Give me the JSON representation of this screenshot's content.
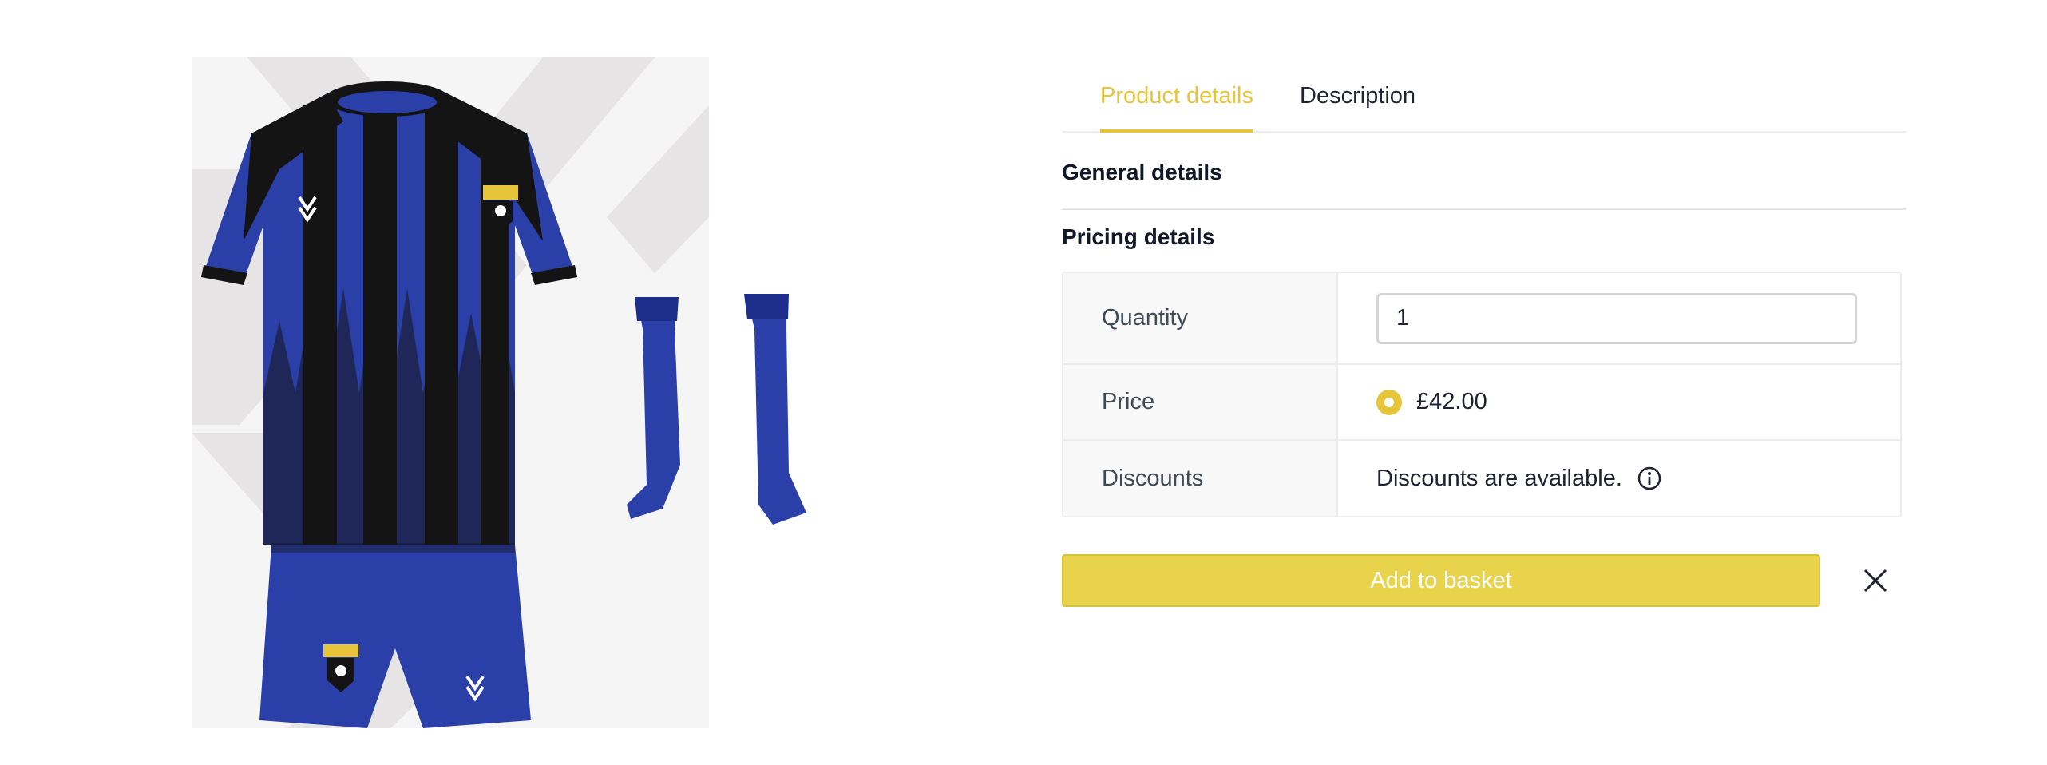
{
  "product_image": {
    "alt": "Blue and black striped football kit with shirt, shorts and socks",
    "colors": {
      "blue": "#2a3fa8",
      "black": "#141414",
      "background_chevron": "#e8e6e6"
    }
  },
  "tabs": [
    {
      "label": "Product details",
      "active": true
    },
    {
      "label": "Description",
      "active": false
    }
  ],
  "sections": {
    "general": "General details",
    "pricing": "Pricing details"
  },
  "pricing": {
    "quantity": {
      "label": "Quantity",
      "value": "1"
    },
    "price": {
      "label": "Price",
      "value": "£42.00",
      "selected": true
    },
    "discounts": {
      "label": "Discounts",
      "value": "Discounts are available.",
      "icon": "info-icon"
    }
  },
  "actions": {
    "add_to_basket": "Add to basket",
    "close_icon": "close-icon"
  },
  "colors": {
    "accent": "#e6c53b",
    "button": "#e8d34a",
    "text": "#1f2230"
  }
}
